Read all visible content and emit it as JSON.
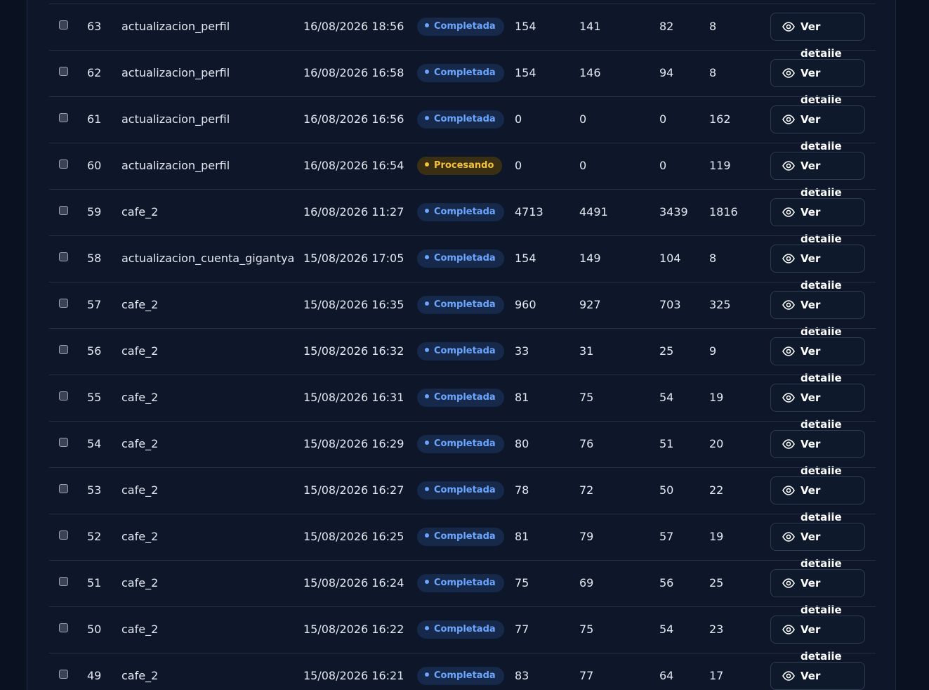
{
  "colors": {
    "background": "#0b1221",
    "panel": "#0e1729",
    "completed": "#6aa6ff",
    "processing": "#f3c13a",
    "text": "#e3e8f1"
  },
  "icons": {
    "row_button": "eye-icon"
  },
  "rows": [
    {
      "id": "63",
      "name": "actualizacion_perfil",
      "date": "16/08/2026 18:56",
      "status": "Completada",
      "status_type": "done",
      "v1": "154",
      "v2": "141",
      "v3": "82",
      "v4": "8",
      "action": "Ver detalle"
    },
    {
      "id": "62",
      "name": "actualizacion_perfil",
      "date": "16/08/2026 16:58",
      "status": "Completada",
      "status_type": "done",
      "v1": "154",
      "v2": "146",
      "v3": "94",
      "v4": "8",
      "action": "Ver detalle"
    },
    {
      "id": "61",
      "name": "actualizacion_perfil",
      "date": "16/08/2026 16:56",
      "status": "Completada",
      "status_type": "done",
      "v1": "0",
      "v2": "0",
      "v3": "0",
      "v4": "162",
      "action": "Ver detalle"
    },
    {
      "id": "60",
      "name": "actualizacion_perfil",
      "date": "16/08/2026 16:54",
      "status": "Procesando",
      "status_type": "proc",
      "v1": "0",
      "v2": "0",
      "v3": "0",
      "v4": "119",
      "action": "Ver detalle"
    },
    {
      "id": "59",
      "name": "cafe_2",
      "date": "16/08/2026 11:27",
      "status": "Completada",
      "status_type": "done",
      "v1": "4713",
      "v2": "4491",
      "v3": "3439",
      "v4": "1816",
      "action": "Ver detalle"
    },
    {
      "id": "58",
      "name": "actualizacion_cuenta_gigantya",
      "date": "15/08/2026 17:05",
      "status": "Completada",
      "status_type": "done",
      "v1": "154",
      "v2": "149",
      "v3": "104",
      "v4": "8",
      "action": "Ver detalle"
    },
    {
      "id": "57",
      "name": "cafe_2",
      "date": "15/08/2026 16:35",
      "status": "Completada",
      "status_type": "done",
      "v1": "960",
      "v2": "927",
      "v3": "703",
      "v4": "325",
      "action": "Ver detalle"
    },
    {
      "id": "56",
      "name": "cafe_2",
      "date": "15/08/2026 16:32",
      "status": "Completada",
      "status_type": "done",
      "v1": "33",
      "v2": "31",
      "v3": "25",
      "v4": "9",
      "action": "Ver detalle"
    },
    {
      "id": "55",
      "name": "cafe_2",
      "date": "15/08/2026 16:31",
      "status": "Completada",
      "status_type": "done",
      "v1": "81",
      "v2": "75",
      "v3": "54",
      "v4": "19",
      "action": "Ver detalle"
    },
    {
      "id": "54",
      "name": "cafe_2",
      "date": "15/08/2026 16:29",
      "status": "Completada",
      "status_type": "done",
      "v1": "80",
      "v2": "76",
      "v3": "51",
      "v4": "20",
      "action": "Ver detalle"
    },
    {
      "id": "53",
      "name": "cafe_2",
      "date": "15/08/2026 16:27",
      "status": "Completada",
      "status_type": "done",
      "v1": "78",
      "v2": "72",
      "v3": "50",
      "v4": "22",
      "action": "Ver detalle"
    },
    {
      "id": "52",
      "name": "cafe_2",
      "date": "15/08/2026 16:25",
      "status": "Completada",
      "status_type": "done",
      "v1": "81",
      "v2": "79",
      "v3": "57",
      "v4": "19",
      "action": "Ver detalle"
    },
    {
      "id": "51",
      "name": "cafe_2",
      "date": "15/08/2026 16:24",
      "status": "Completada",
      "status_type": "done",
      "v1": "75",
      "v2": "69",
      "v3": "56",
      "v4": "25",
      "action": "Ver detalle"
    },
    {
      "id": "50",
      "name": "cafe_2",
      "date": "15/08/2026 16:22",
      "status": "Completada",
      "status_type": "done",
      "v1": "77",
      "v2": "75",
      "v3": "54",
      "v4": "23",
      "action": "Ver detalle"
    },
    {
      "id": "49",
      "name": "cafe_2",
      "date": "15/08/2026 16:21",
      "status": "Completada",
      "status_type": "done",
      "v1": "83",
      "v2": "77",
      "v3": "64",
      "v4": "17",
      "action": "Ver detalle"
    }
  ]
}
